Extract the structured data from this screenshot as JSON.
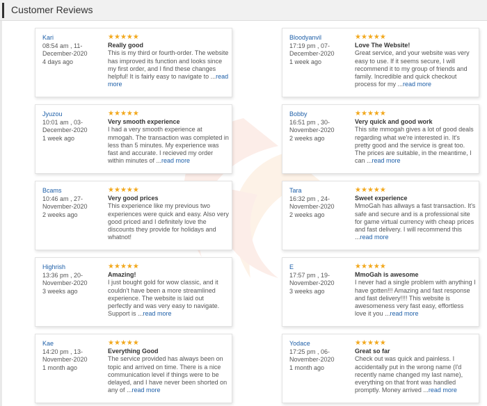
{
  "header": {
    "title": "Customer Reviews"
  },
  "colors": {
    "star": "#f2a81d",
    "link": "#1e5fa8"
  },
  "reviews": [
    {
      "name": "Kari",
      "date": "08:54 am , 11-December-2020",
      "ago": "4 days ago",
      "rating": 5,
      "title": "Really good",
      "text": "This is my third or fourth-order. The website has improved its function and looks since my first order, and I find these changes helpful! It is fairly easy to navigate to ...",
      "read_more": "read more"
    },
    {
      "name": "Bloodyanvil",
      "date": "17:19 pm , 07-December-2020",
      "ago": "1 week ago",
      "rating": 5,
      "title": "Love The Website!",
      "text": "Great service, and your website was very easy to use. If it seems secure, I will recommend it to my group of friends and family. Incredible and quick checkout process for my ...",
      "read_more": "read more"
    },
    {
      "name": "Jyuzou",
      "date": "10:01 am , 03-December-2020",
      "ago": "1 week ago",
      "rating": 5,
      "title": "Very smooth experience",
      "text": "I had a very smooth experience at mmogah. The transaction was completed in less than 5 minutes. My experience was fast and accurate. I recieved my order within minutes of ...",
      "read_more": "read more"
    },
    {
      "name": "Bobby",
      "date": "16:51 pm , 30-November-2020",
      "ago": "2 weeks ago",
      "rating": 5,
      "title": "Very quick and good work",
      "text": "This site mmogah gives a lot of good deals regarding what we're interested in. It's pretty good and the service is great too. The prices are suitable, in the meantime, I can ...",
      "read_more": "read more"
    },
    {
      "name": "Bcams",
      "date": "10:46 am , 27-November-2020",
      "ago": "2 weeks ago",
      "rating": 5,
      "title": "Very good prices",
      "text": "This experience like my previous two experiences were quick and easy. Also very good priced and I definitely love the discounts they provide for holidays and whatnot!",
      "read_more": ""
    },
    {
      "name": "Tara",
      "date": "16:32 pm , 24-November-2020",
      "ago": "2 weeks ago",
      "rating": 5,
      "title": "Sweet experience",
      "text": "MmoGah has allways a fast transaction. It's safe and secure and is a professional site for game virtual currency with cheap prices and fast delivery. I will recommend this ...",
      "read_more": "read more"
    },
    {
      "name": "Highrish",
      "date": "13:36 pm , 20-November-2020",
      "ago": "3 weeks ago",
      "rating": 5,
      "title": "Amazing!",
      "text": "I just bought gold for wow classic, and it couldn't have been a more streamlined experience. The website is laid out perfectly and was very easy to navigate. Support is ...",
      "read_more": "read more"
    },
    {
      "name": "E",
      "date": "17:57 pm , 19-November-2020",
      "ago": "3 weeks ago",
      "rating": 5,
      "title": "MmoGah is awesome",
      "text": "I never had a single problem with anything I have gotten!!! Amazing and fast response and fast delivery!!!! This website is awesomeness very fast easy, effortless love it you ...",
      "read_more": "read more"
    },
    {
      "name": "Kae",
      "date": "14:20 pm , 13-November-2020",
      "ago": "1 month ago",
      "rating": 5,
      "title": "Everything Good",
      "text": "The service provided has always been on topic and arrived on time. There is a nice communication level if things were to be delayed, and I have never been shorted on any of ...",
      "read_more": "read more"
    },
    {
      "name": "Yodace",
      "date": "17:25 pm , 06-November-2020",
      "ago": "1 month ago",
      "rating": 5,
      "title": "Great so far",
      "text": "Check out was quick and painless. I accidentally put in the wrong name (I'd recently name changed my last name), everything on that front was handled promptly. Money arrived ...",
      "read_more": "read more"
    }
  ]
}
